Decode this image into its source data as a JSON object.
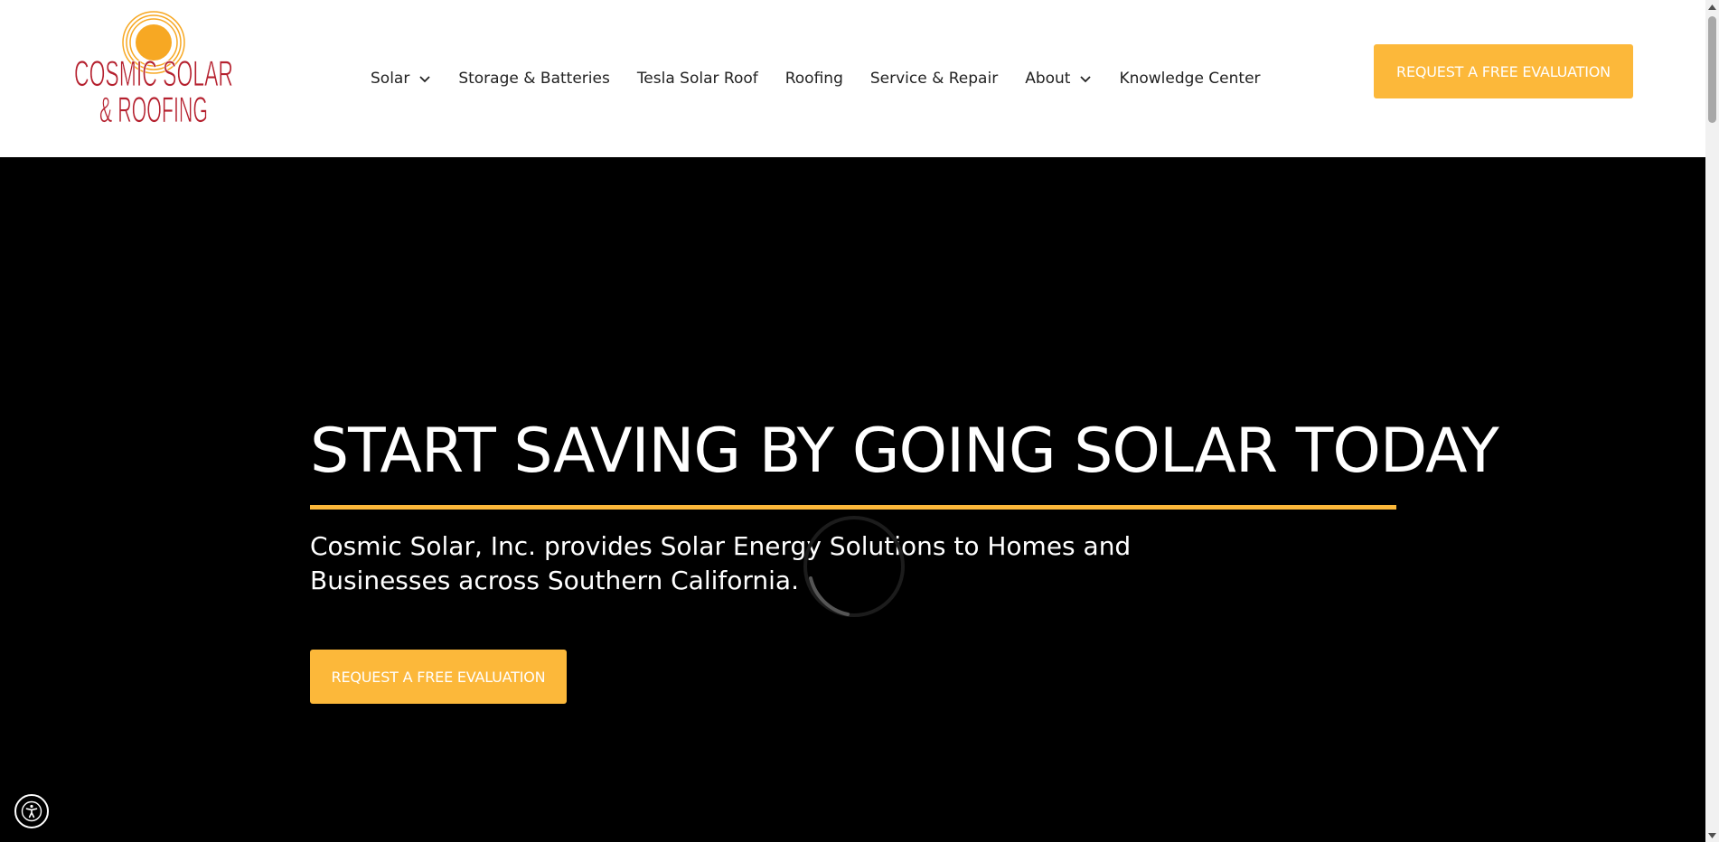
{
  "header": {
    "logo": {
      "line1": "COSMIC SOLAR",
      "line2": "& ROOFING",
      "icon": "sun-logo"
    },
    "nav": [
      {
        "label": "Solar",
        "has_dropdown": true
      },
      {
        "label": "Storage & Batteries",
        "has_dropdown": false
      },
      {
        "label": "Tesla Solar Roof",
        "has_dropdown": false
      },
      {
        "label": "Roofing",
        "has_dropdown": false
      },
      {
        "label": "Service & Repair",
        "has_dropdown": false
      },
      {
        "label": "About",
        "has_dropdown": true
      },
      {
        "label": "Knowledge Center",
        "has_dropdown": false
      }
    ],
    "cta_label": "REQUEST A FREE EVALUATION"
  },
  "hero": {
    "title": "START SAVING BY GOING SOLAR TODAY",
    "subtitle": "Cosmic Solar, Inc. provides Solar Energy Solutions to Homes and Businesses across Southern California.",
    "cta_label": "REQUEST A FREE EVALUATION"
  },
  "colors": {
    "accent": "#fcb83a",
    "logo_red": "#b5202e",
    "logo_orange": "#f7a823",
    "hero_bg": "#000000"
  },
  "icons": {
    "accessibility": "accessibility-icon",
    "loading": "loading-spinner-icon"
  }
}
